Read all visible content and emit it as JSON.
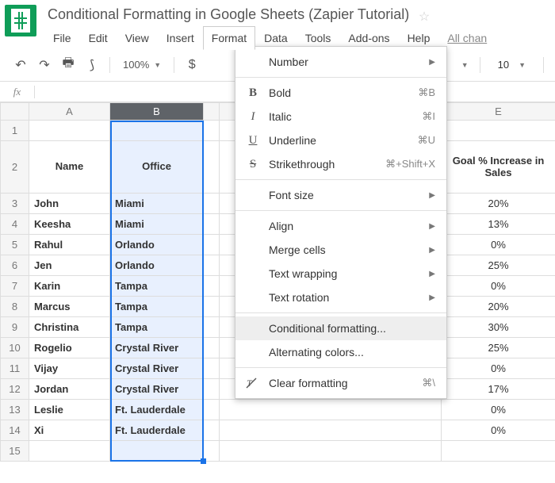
{
  "doc": {
    "title": "Conditional Formatting in Google Sheets (Zapier Tutorial)"
  },
  "menus": {
    "file": "File",
    "edit": "Edit",
    "view": "View",
    "insert": "Insert",
    "format": "Format",
    "data": "Data",
    "tools": "Tools",
    "addons": "Add-ons",
    "help": "Help",
    "all_changes": "All chan"
  },
  "toolbar": {
    "zoom": "100%",
    "currency": "$",
    "font_size": "10"
  },
  "fx": {
    "label": "fx"
  },
  "columns": {
    "A": "A",
    "B": "B",
    "E": "E"
  },
  "headers": {
    "name": "Name",
    "office": "Office",
    "goal": "Goal % Increase in Sales"
  },
  "rows": [
    {
      "n": "1"
    },
    {
      "n": "2"
    },
    {
      "n": "3",
      "name": "John",
      "office": "Miami",
      "goal": "20%"
    },
    {
      "n": "4",
      "name": "Keesha",
      "office": "Miami",
      "goal": "13%"
    },
    {
      "n": "5",
      "name": "Rahul",
      "office": "Orlando",
      "goal": "0%"
    },
    {
      "n": "6",
      "name": "Jen",
      "office": "Orlando",
      "goal": "25%"
    },
    {
      "n": "7",
      "name": "Karin",
      "office": "Tampa",
      "goal": "0%"
    },
    {
      "n": "8",
      "name": "Marcus",
      "office": "Tampa",
      "goal": "20%"
    },
    {
      "n": "9",
      "name": "Christina",
      "office": "Tampa",
      "goal": "30%"
    },
    {
      "n": "10",
      "name": "Rogelio",
      "office": "Crystal River",
      "goal": "25%"
    },
    {
      "n": "11",
      "name": "Vijay",
      "office": "Crystal River",
      "goal": "0%"
    },
    {
      "n": "12",
      "name": "Jordan",
      "office": "Crystal River",
      "goal": "17%"
    },
    {
      "n": "13",
      "name": "Leslie",
      "office": "Ft. Lauderdale",
      "goal": "0%"
    },
    {
      "n": "14",
      "name": "Xi",
      "office": "Ft. Lauderdale",
      "goal": "0%"
    },
    {
      "n": "15"
    }
  ],
  "format_menu": {
    "number": "Number",
    "bold": {
      "label": "Bold",
      "shortcut": "⌘B"
    },
    "italic": {
      "label": "Italic",
      "shortcut": "⌘I"
    },
    "underline": {
      "label": "Underline",
      "shortcut": "⌘U"
    },
    "strike": {
      "label": "Strikethrough",
      "shortcut": "⌘+Shift+X"
    },
    "font_size": "Font size",
    "align": "Align",
    "merge": "Merge cells",
    "wrap": "Text wrapping",
    "rotation": "Text rotation",
    "conditional": "Conditional formatting...",
    "alternating": "Alternating colors...",
    "clear": {
      "label": "Clear formatting",
      "shortcut": "⌘\\"
    }
  }
}
